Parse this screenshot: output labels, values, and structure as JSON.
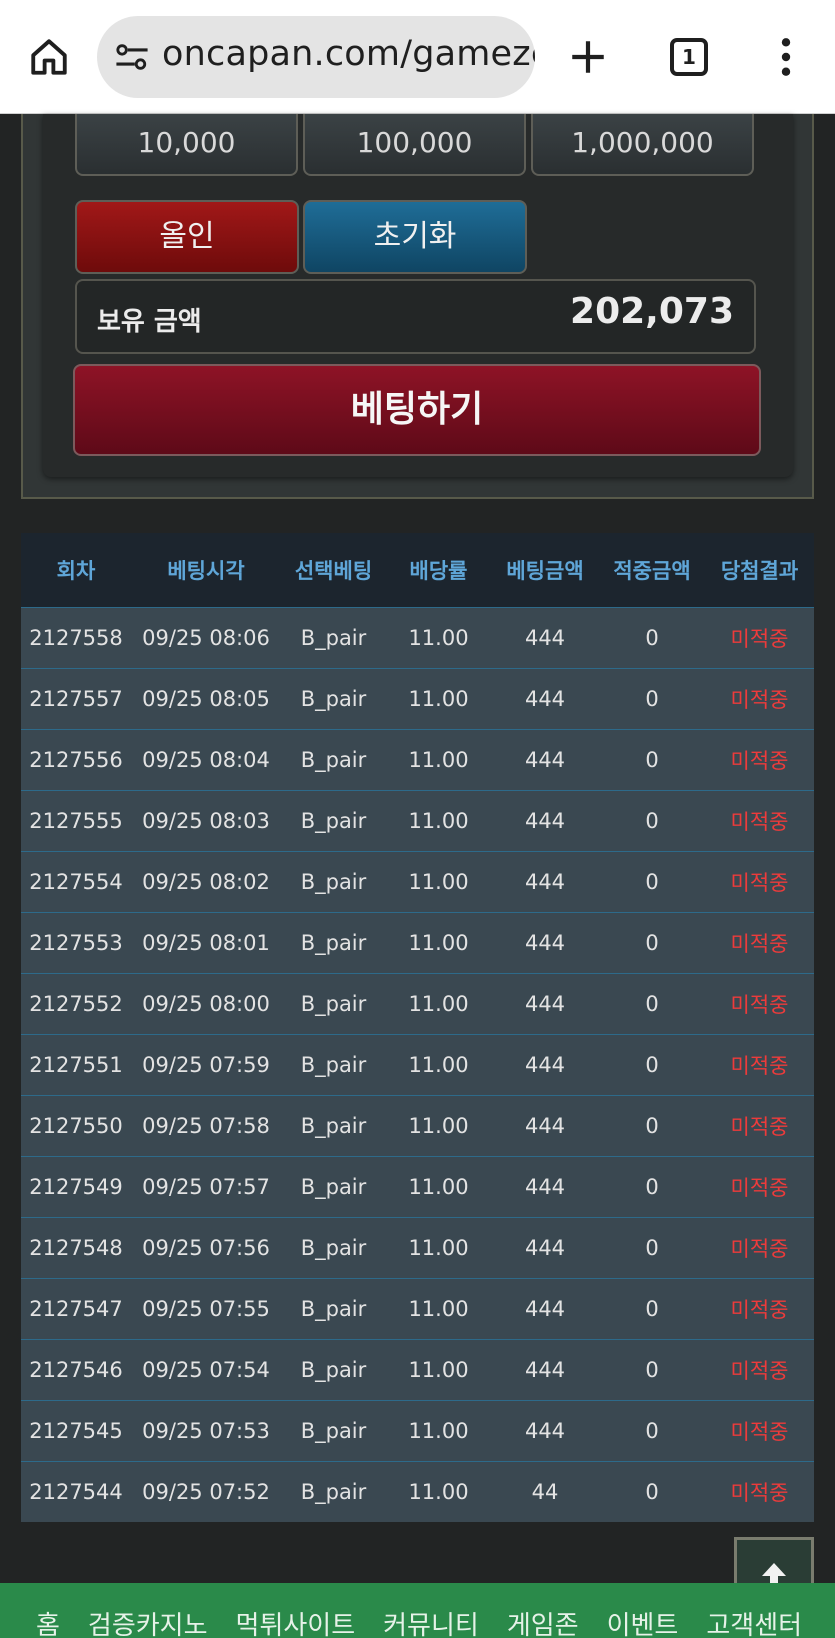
{
  "browser": {
    "url": "oncapan.com/gamezc",
    "tab_count": "1"
  },
  "bet_panel": {
    "amount_buttons": [
      "10,000",
      "100,000",
      "1,000,000"
    ],
    "allin_label": "올인",
    "reset_label": "초기화",
    "balance_label": "보유 금액",
    "balance_value": "202,073",
    "bet_button_label": "베팅하기"
  },
  "history": {
    "columns": [
      "회차",
      "베팅시각",
      "선택베팅",
      "배당률",
      "베팅금액",
      "적중금액",
      "당첨결과"
    ],
    "rows": [
      [
        "2127558",
        "09/25 08:06",
        "B_pair",
        "11.00",
        "444",
        "0",
        "미적중"
      ],
      [
        "2127557",
        "09/25 08:05",
        "B_pair",
        "11.00",
        "444",
        "0",
        "미적중"
      ],
      [
        "2127556",
        "09/25 08:04",
        "B_pair",
        "11.00",
        "444",
        "0",
        "미적중"
      ],
      [
        "2127555",
        "09/25 08:03",
        "B_pair",
        "11.00",
        "444",
        "0",
        "미적중"
      ],
      [
        "2127554",
        "09/25 08:02",
        "B_pair",
        "11.00",
        "444",
        "0",
        "미적중"
      ],
      [
        "2127553",
        "09/25 08:01",
        "B_pair",
        "11.00",
        "444",
        "0",
        "미적중"
      ],
      [
        "2127552",
        "09/25 08:00",
        "B_pair",
        "11.00",
        "444",
        "0",
        "미적중"
      ],
      [
        "2127551",
        "09/25 07:59",
        "B_pair",
        "11.00",
        "444",
        "0",
        "미적중"
      ],
      [
        "2127550",
        "09/25 07:58",
        "B_pair",
        "11.00",
        "444",
        "0",
        "미적중"
      ],
      [
        "2127549",
        "09/25 07:57",
        "B_pair",
        "11.00",
        "444",
        "0",
        "미적중"
      ],
      [
        "2127548",
        "09/25 07:56",
        "B_pair",
        "11.00",
        "444",
        "0",
        "미적중"
      ],
      [
        "2127547",
        "09/25 07:55",
        "B_pair",
        "11.00",
        "444",
        "0",
        "미적중"
      ],
      [
        "2127546",
        "09/25 07:54",
        "B_pair",
        "11.00",
        "444",
        "0",
        "미적중"
      ],
      [
        "2127545",
        "09/25 07:53",
        "B_pair",
        "11.00",
        "444",
        "0",
        "미적중"
      ],
      [
        "2127544",
        "09/25 07:52",
        "B_pair",
        "11.00",
        "44",
        "0",
        "미적중"
      ]
    ]
  },
  "footer_nav": [
    "홈",
    "검증카지노",
    "먹튀사이트",
    "커뮤니티",
    "게임존",
    "이벤트",
    "고객센터"
  ],
  "icons": {
    "home": "home-icon",
    "site_settings": "tune-icon",
    "new_tab": "plus-icon",
    "tab_switcher": "tab-count-icon",
    "menu": "more-vert-icon",
    "scroll_top": "arrow-up-icon"
  },
  "colors": {
    "header_text": "#5fa6d8",
    "miss_text": "#ee3b3b",
    "allin_button": "#a11818",
    "reset_button": "#1f6d97",
    "bet_button": "#8e1326",
    "footer_bg": "#2a8a4a"
  }
}
